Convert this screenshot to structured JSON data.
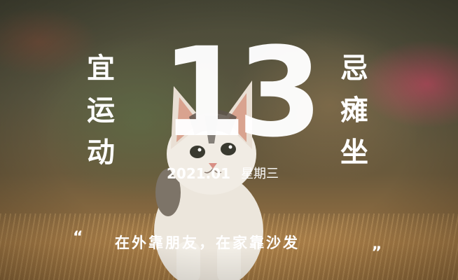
{
  "good_for": {
    "label": "宜",
    "activity": [
      "运",
      "动"
    ]
  },
  "avoid": {
    "label": "忌",
    "activity": [
      "瘫",
      "坐"
    ]
  },
  "day": "13",
  "date": "2021.01",
  "weekday": "星期三",
  "quote": {
    "open_mark": "“",
    "text": "在外靠朋友，在家靠沙发",
    "close_mark": "„"
  },
  "colors": {
    "text": "#ffffff"
  }
}
